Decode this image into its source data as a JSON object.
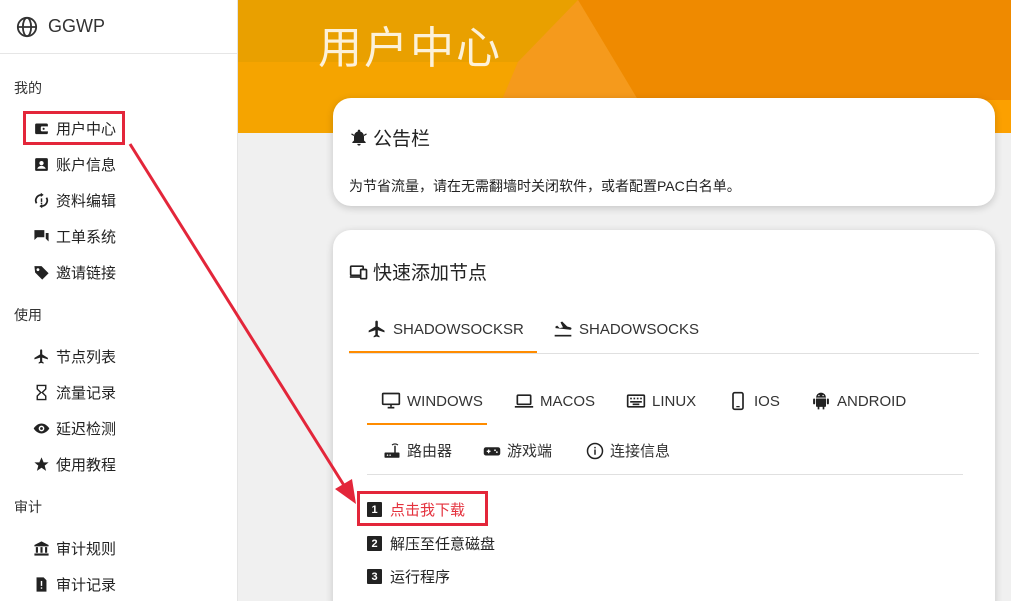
{
  "brand": {
    "name": "GGWP",
    "icon": "globe-icon"
  },
  "sidebar": {
    "sections": [
      {
        "title": "我的",
        "items": [
          {
            "label": "用户中心",
            "icon": "wallet-icon"
          },
          {
            "label": "账户信息",
            "icon": "account-box-icon"
          },
          {
            "label": "资料编辑",
            "icon": "sync-icon"
          },
          {
            "label": "工单系统",
            "icon": "forum-icon"
          },
          {
            "label": "邀请链接",
            "icon": "tag-icon"
          }
        ]
      },
      {
        "title": "使用",
        "items": [
          {
            "label": "节点列表",
            "icon": "airplane-icon"
          },
          {
            "label": "流量记录",
            "icon": "hourglass-icon"
          },
          {
            "label": "延迟检测",
            "icon": "eye-icon"
          },
          {
            "label": "使用教程",
            "icon": "star-icon"
          }
        ]
      },
      {
        "title": "审计",
        "items": [
          {
            "label": "审计规则",
            "icon": "bank-icon"
          },
          {
            "label": "审计记录",
            "icon": "report-icon"
          }
        ]
      }
    ]
  },
  "header": {
    "title": "用户中心"
  },
  "notice": {
    "title": "公告栏",
    "text": "为节省流量，请在无需翻墙时关闭软件，或者配置PAC白名单。"
  },
  "quick_add": {
    "title": "快速添加节点",
    "protocol_tabs": [
      "SHADOWSOCKSR",
      "SHADOWSOCKS"
    ],
    "platform_tabs": [
      "WINDOWS",
      "MACOS",
      "LINUX",
      "IOS",
      "ANDROID"
    ],
    "extra_tabs": [
      "路由器",
      "游戏端",
      "连接信息"
    ],
    "steps": [
      "点击我下载",
      "解压至任意磁盘",
      "运行程序"
    ]
  },
  "colors": {
    "accent": "#ff8c00",
    "header_orange": "#f7941d",
    "link_red": "#e4313d",
    "annotation_red": "#e3263a"
  }
}
